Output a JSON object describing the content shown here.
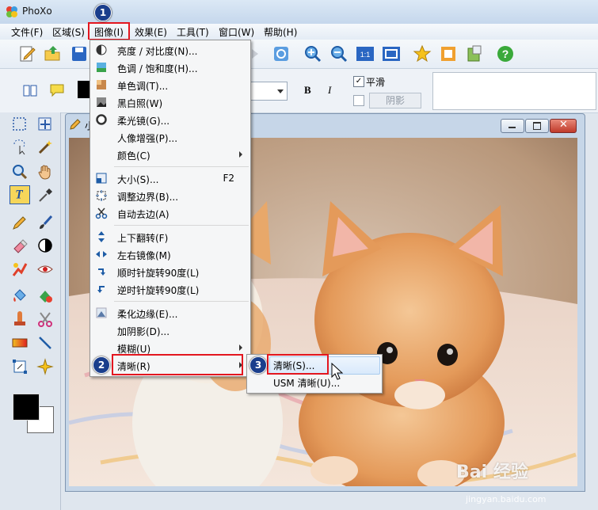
{
  "app": {
    "title": "PhoXo"
  },
  "menubar": {
    "items": [
      {
        "label": "文件(F)"
      },
      {
        "label": "区域(S)"
      },
      {
        "label": "图像(I)"
      },
      {
        "label": "效果(E)"
      },
      {
        "label": "工具(T)"
      },
      {
        "label": "窗口(W)"
      },
      {
        "label": "帮助(H)"
      }
    ]
  },
  "optbar": {
    "smooth_label": "平滑",
    "shadow_label": "阴影",
    "bold": "B",
    "italic": "I",
    "smooth_checked": true
  },
  "image_window": {
    "title_short": "小"
  },
  "image_menu": {
    "items": [
      {
        "label": "亮度 / 对比度(N)...",
        "icon": "brightness-icon"
      },
      {
        "label": "色调 / 饱和度(H)...",
        "icon": "hue-icon"
      },
      {
        "label": "单色调(T)...",
        "icon": "monotone-icon"
      },
      {
        "label": "黑白照(W)",
        "icon": "bw-photo-icon"
      },
      {
        "label": "柔光镜(G)...",
        "icon": "soft-light-icon"
      },
      {
        "label": "人像增强(P)...",
        "icon": ""
      },
      {
        "label": "颜色(C)",
        "icon": "",
        "submenu": true
      },
      {
        "label": "大小(S)...",
        "icon": "resize-icon",
        "shortcut": "F2"
      },
      {
        "label": "调整边界(B)...",
        "icon": "border-icon"
      },
      {
        "label": "自动去边(A)",
        "icon": "scissors-icon"
      },
      {
        "label": "上下翻转(F)",
        "icon": "flip-vertical-icon"
      },
      {
        "label": "左右镜像(M)",
        "icon": "mirror-horizontal-icon"
      },
      {
        "label": "顺时针旋转90度(L)",
        "icon": "rotate-cw-icon"
      },
      {
        "label": "逆时针旋转90度(L)",
        "icon": "rotate-ccw-icon"
      },
      {
        "label": "柔化边缘(E)...",
        "icon": "soften-edge-icon"
      },
      {
        "label": "加阴影(D)...",
        "icon": ""
      },
      {
        "label": "模糊(U)",
        "icon": "",
        "submenu": true
      },
      {
        "label": "清晰(R)",
        "icon": "",
        "submenu": true
      }
    ]
  },
  "sharpen_submenu": {
    "items": [
      {
        "label": "清晰(S)..."
      },
      {
        "label": "USM 清晰(U)..."
      }
    ]
  },
  "steps": [
    "1",
    "2",
    "3"
  ],
  "watermark": {
    "text": "Bai 经验",
    "url": "jingyan.baidu.com"
  },
  "colors": {
    "accent_red": "#e3161f",
    "badge_blue": "#1a3e8c",
    "fg_color": "#000000",
    "bg_color": "#ffffff"
  }
}
